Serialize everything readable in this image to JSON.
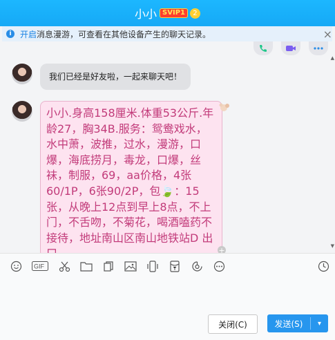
{
  "window": {
    "title": "小小",
    "vip_badge": "SVIP1",
    "level_badge": "2"
  },
  "notice": {
    "link_text": "开启",
    "text": "消息漫游，可查看在其他设备产生的聊天记录。",
    "close": "×"
  },
  "chat": {
    "messages": [
      {
        "text": "我们已经是好友啦，一起来聊天吧！"
      },
      {
        "text": "小小.身高158厘米.体重53公斤.年龄27，胸34B.服务：鸳鸯戏水，水中萧，波推，过水，漫游，口爆，海底捞月，毒龙，口爆，丝袜，制服，69，aa价格，4张60/1P，6张90/2P，包🍃：15张，从晚上12点到早上8点，不上门，不舌吻，不菊花，喝酒嗑药不接待，地址南山区南山地铁站D 出口"
      }
    ],
    "plus_icon": "+"
  },
  "buttons": {
    "close": "关闭(C)",
    "send": "发送(S)"
  },
  "colors": {
    "titlebar": "#17adf9",
    "accent": "#2796ee",
    "bubble_pink": "#fde3f0",
    "bubble_text": "#c23b7a"
  }
}
